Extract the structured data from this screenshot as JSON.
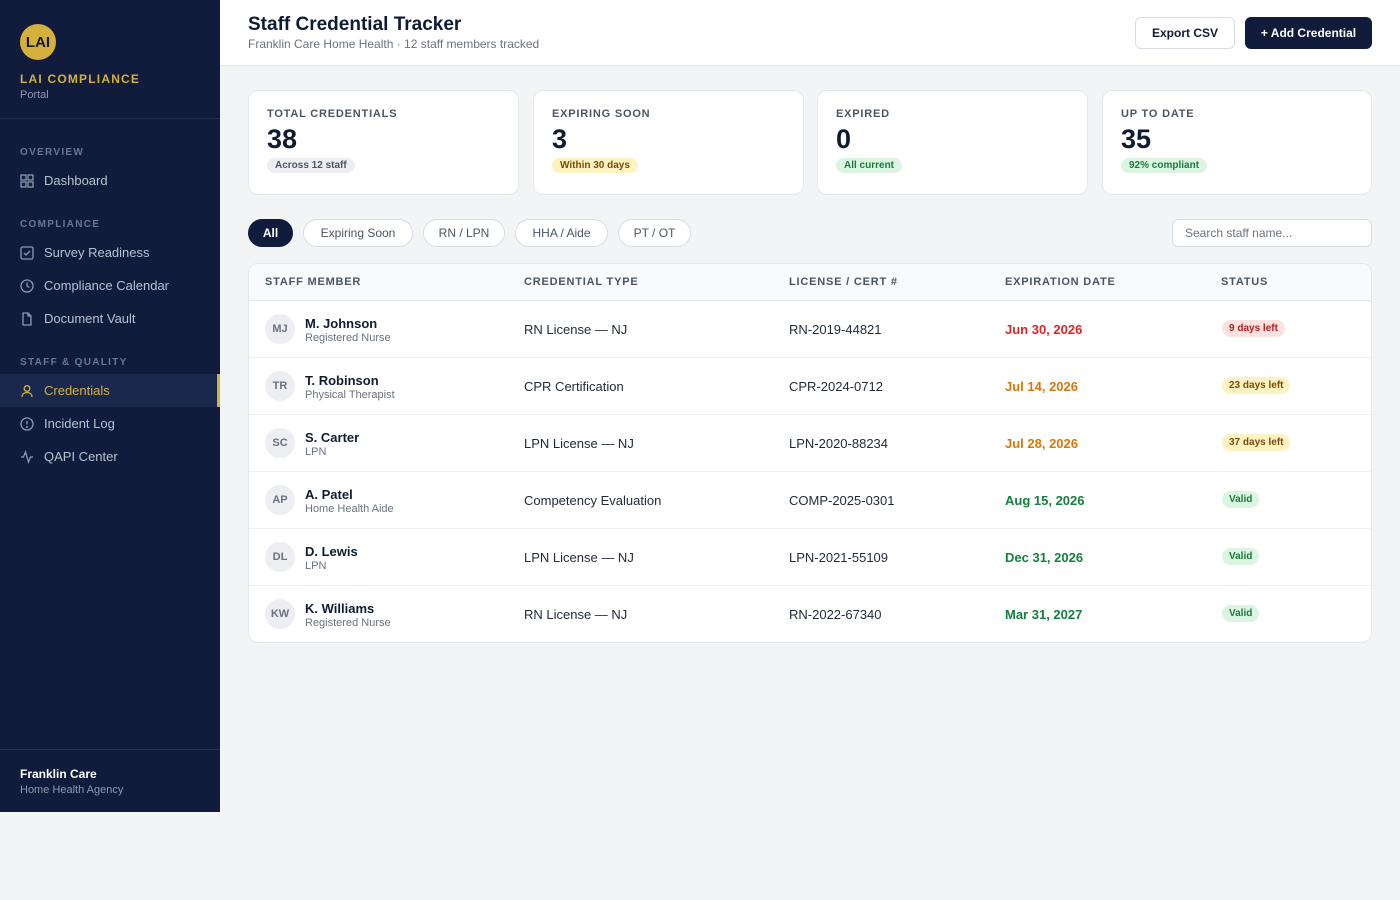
{
  "sidebar": {
    "logo_text": "LAI",
    "brand_name": "LAI COMPLIANCE",
    "brand_sub": "Portal",
    "sections": {
      "overview": "OVERVIEW",
      "compliance": "COMPLIANCE",
      "staff_quality": "STAFF & QUALITY"
    },
    "items": {
      "dashboard": "Dashboard",
      "survey_readiness": "Survey Readiness",
      "compliance_calendar": "Compliance Calendar",
      "document_vault": "Document Vault",
      "credentials": "Credentials",
      "incident_log": "Incident Log",
      "qapi_center": "QAPI Center"
    },
    "active_item": "credentials",
    "footer_title": "Franklin Care",
    "footer_sub": "Home Health Agency"
  },
  "header": {
    "title": "Staff Credential Tracker",
    "subtitle": "Franklin Care Home Health · 12 staff members tracked",
    "export_label": "Export CSV",
    "add_label": "+ Add Credential"
  },
  "stats": [
    {
      "label": "TOTAL CREDENTIALS",
      "value": "38",
      "pill": "Across 12 staff",
      "tone": "gray"
    },
    {
      "label": "EXPIRING SOON",
      "value": "3",
      "pill": "Within 30 days",
      "tone": "yellow"
    },
    {
      "label": "EXPIRED",
      "value": "0",
      "pill": "All current",
      "tone": "green"
    },
    {
      "label": "UP TO DATE",
      "value": "35",
      "pill": "92% compliant",
      "tone": "green"
    }
  ],
  "filters": {
    "chips": [
      "All",
      "Expiring Soon",
      "RN / LPN",
      "HHA / Aide",
      "PT / OT"
    ],
    "active": "All",
    "search_placeholder": "Search staff name..."
  },
  "table": {
    "columns": [
      "STAFF MEMBER",
      "CREDENTIAL TYPE",
      "LICENSE / CERT #",
      "EXPIRATION DATE",
      "STATUS"
    ],
    "rows": [
      {
        "initials": "MJ",
        "name": "M. Johnson",
        "role": "Registered Nurse",
        "credential": "RN License — NJ",
        "license": "RN-2019-44821",
        "expiration": "Jun 30, 2026",
        "status": "9 days left",
        "tone": "red"
      },
      {
        "initials": "TR",
        "name": "T. Robinson",
        "role": "Physical Therapist",
        "credential": "CPR Certification",
        "license": "CPR-2024-0712",
        "expiration": "Jul 14, 2026",
        "status": "23 days left",
        "tone": "yellow"
      },
      {
        "initials": "SC",
        "name": "S. Carter",
        "role": "LPN",
        "credential": "LPN License — NJ",
        "license": "LPN-2020-88234",
        "expiration": "Jul 28, 2026",
        "status": "37 days left",
        "tone": "yellow"
      },
      {
        "initials": "AP",
        "name": "A. Patel",
        "role": "Home Health Aide",
        "credential": "Competency Evaluation",
        "license": "COMP-2025-0301",
        "expiration": "Aug 15, 2026",
        "status": "Valid",
        "tone": "green"
      },
      {
        "initials": "DL",
        "name": "D. Lewis",
        "role": "LPN",
        "credential": "LPN License — NJ",
        "license": "LPN-2021-55109",
        "expiration": "Dec 31, 2026",
        "status": "Valid",
        "tone": "green"
      },
      {
        "initials": "KW",
        "name": "K. Williams",
        "role": "Registered Nurse",
        "credential": "RN License — NJ",
        "license": "RN-2022-67340",
        "expiration": "Mar 31, 2027",
        "status": "Valid",
        "tone": "green"
      }
    ]
  },
  "colors": {
    "navy": "#111c3d",
    "gold": "#d4b03c",
    "red": "#dc2626",
    "orange": "#d97706",
    "green": "#15803d"
  }
}
